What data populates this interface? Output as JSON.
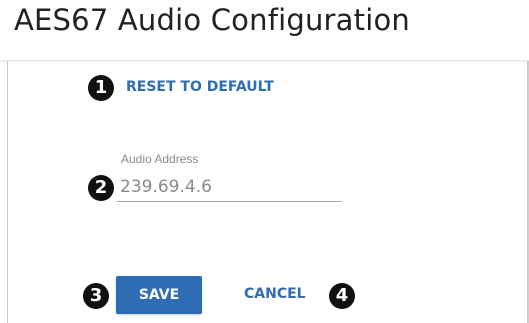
{
  "header": {
    "title": "AES67 Audio Configuration"
  },
  "actions": {
    "reset_label": "RESET TO DEFAULT",
    "save_label": "SAVE",
    "cancel_label": "CANCEL"
  },
  "form": {
    "audio_address": {
      "label": "Audio Address",
      "value": "239.69.4.6"
    }
  },
  "callouts": [
    "1",
    "2",
    "3",
    "4"
  ],
  "colors": {
    "accent": "#2e6db4",
    "callout": "#111111",
    "muted_text": "#8a8a8a"
  }
}
